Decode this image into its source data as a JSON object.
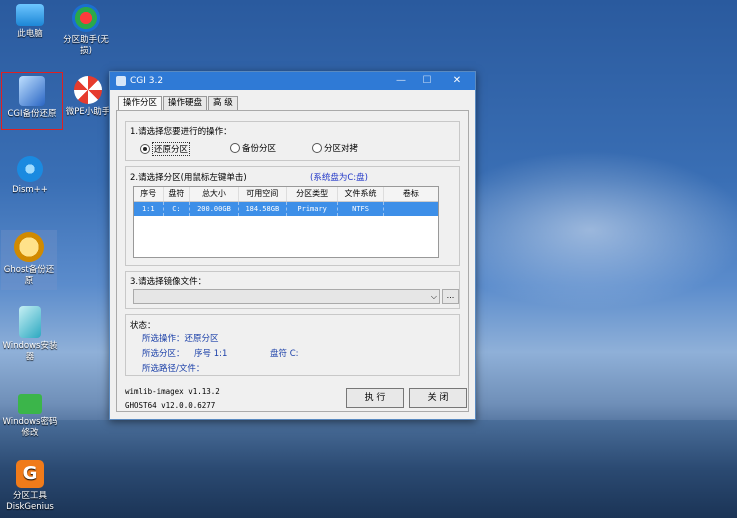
{
  "desktop": {
    "icons": [
      {
        "label": "此电脑"
      },
      {
        "label": "分区助手(无损)"
      },
      {
        "label": "CGI备份还原"
      },
      {
        "label": "微PE小助手"
      },
      {
        "label": "Dism++"
      },
      {
        "label": "Ghost备份还原"
      },
      {
        "label": "Windows安装器"
      },
      {
        "label": "Windows密码修改"
      },
      {
        "label": "分区工具DiskGenius"
      }
    ]
  },
  "window": {
    "title": "CGI 3.2",
    "controls": {
      "minimize": "—",
      "maximize": "☐",
      "close": "✕"
    },
    "tabs": [
      "操作分区",
      "操作硬盘",
      "高 级"
    ],
    "step1": {
      "heading": "1.请选择您要进行的操作：",
      "options": [
        "还原分区",
        "备份分区",
        "分区对拷"
      ],
      "selected": 0
    },
    "step2": {
      "heading": "2.请选择分区(用鼠标左键单击)",
      "system_note": "(系统盘为C:盘)",
      "columns": [
        "序号",
        "盘符",
        "总大小",
        "可用空间",
        "分区类型",
        "文件系统",
        "卷标"
      ],
      "rows": [
        [
          "1:1",
          "C:",
          "200.00GB",
          "184.58GB",
          "Primary",
          "NTFS",
          ""
        ]
      ]
    },
    "step3": {
      "heading": "3.请选择镜像文件：",
      "combo_value": "",
      "browse_label": "..."
    },
    "status": {
      "heading": "状态：",
      "operation": "所选操作：还原分区",
      "partition_label": "所选分区：",
      "partition_no": "序号 1:1",
      "drive_letter": "盘符 C:",
      "path": "所选路径/文件："
    },
    "versions": [
      "wimlib-imagex v1.13.2",
      "GHOST64 v12.0.0.6277"
    ],
    "buttons": {
      "execute": "执 行",
      "close": "关 闭"
    }
  }
}
